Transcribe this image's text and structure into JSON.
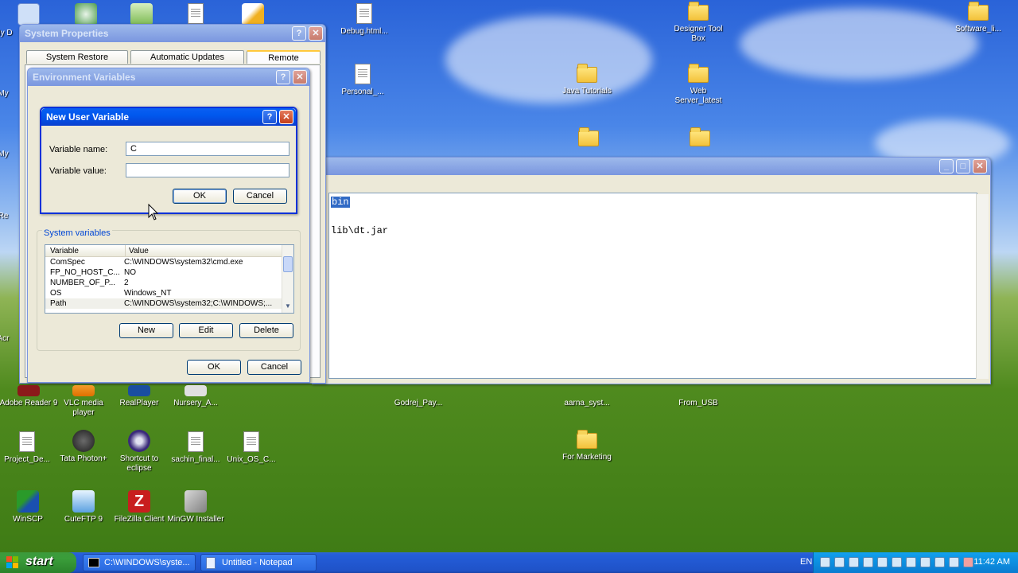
{
  "desktop": {
    "icons": [
      {
        "id": "debug",
        "label": "Debug.html...",
        "kind": "doc"
      },
      {
        "id": "designer",
        "label": "Designer Tool Box",
        "kind": "folder"
      },
      {
        "id": "software",
        "label": "Software_li...",
        "kind": "folder"
      },
      {
        "id": "personal",
        "label": "Personal_...",
        "kind": "doc"
      },
      {
        "id": "java",
        "label": "Java Tutorials",
        "kind": "folder"
      },
      {
        "id": "webserver",
        "label": "Web Server_latest",
        "kind": "folder"
      },
      {
        "id": "adobe",
        "label": "Adobe Reader 9",
        "kind": "app"
      },
      {
        "id": "vlc",
        "label": "VLC media player",
        "kind": "app"
      },
      {
        "id": "realplayer",
        "label": "RealPlayer",
        "kind": "app"
      },
      {
        "id": "nursery",
        "label": "Nursery_A...",
        "kind": "app"
      },
      {
        "id": "godrej",
        "label": "Godrej_Pay...",
        "kind": "app"
      },
      {
        "id": "aarna",
        "label": "aarna_syst...",
        "kind": "app"
      },
      {
        "id": "fromusb",
        "label": "From_USB",
        "kind": "app"
      },
      {
        "id": "project",
        "label": "Project_De...",
        "kind": "doc"
      },
      {
        "id": "tata",
        "label": "Tata Photon+",
        "kind": "app"
      },
      {
        "id": "eclipse",
        "label": "Shortcut to eclipse",
        "kind": "app"
      },
      {
        "id": "sachin",
        "label": "sachin_final...",
        "kind": "doc"
      },
      {
        "id": "unix",
        "label": "Unix_OS_C...",
        "kind": "doc"
      },
      {
        "id": "marketing",
        "label": "For Marketing",
        "kind": "folder"
      },
      {
        "id": "winscp",
        "label": "WinSCP",
        "kind": "app"
      },
      {
        "id": "cuteftp",
        "label": "CuteFTP 9",
        "kind": "app"
      },
      {
        "id": "filezilla",
        "label": "FileZilla Client",
        "kind": "app"
      },
      {
        "id": "mingw",
        "label": "MinGW Installer",
        "kind": "app"
      }
    ],
    "left_edge_labels": [
      "My D",
      "My",
      "My",
      "Re",
      "Acr"
    ]
  },
  "notepad": {
    "lines": [
      "bin",
      "lib\\dt.jar"
    ]
  },
  "system_properties": {
    "title": "System Properties",
    "tabs": [
      "System Restore",
      "Automatic Updates",
      "Remote"
    ]
  },
  "env_vars": {
    "title": "Environment Variables",
    "system_vars_label": "System variables",
    "columns": [
      "Variable",
      "Value"
    ],
    "rows": [
      [
        "ComSpec",
        "C:\\WINDOWS\\system32\\cmd.exe"
      ],
      [
        "FP_NO_HOST_C...",
        "NO"
      ],
      [
        "NUMBER_OF_P...",
        "2"
      ],
      [
        "OS",
        "Windows_NT"
      ],
      [
        "Path",
        "C:\\WINDOWS\\system32;C:\\WINDOWS;..."
      ]
    ],
    "new_label": "New",
    "edit_label": "Edit",
    "delete_label": "Delete",
    "ok_label": "OK",
    "cancel_label": "Cancel"
  },
  "new_user_var": {
    "title": "New User Variable",
    "name_label": "Variable name:",
    "value_label": "Variable value:",
    "name_value": "C",
    "value_value": "",
    "ok_label": "OK",
    "cancel_label": "Cancel"
  },
  "taskbar": {
    "start_label": "start",
    "items": [
      "C:\\WINDOWS\\syste...",
      "Untitled - Notepad"
    ],
    "lang": "EN",
    "clock": "11:42 AM"
  },
  "colors": {
    "xp_blue": "#0a5ff2",
    "start_green": "#3a9d3a",
    "tray_blue": "#0c8fe0"
  }
}
